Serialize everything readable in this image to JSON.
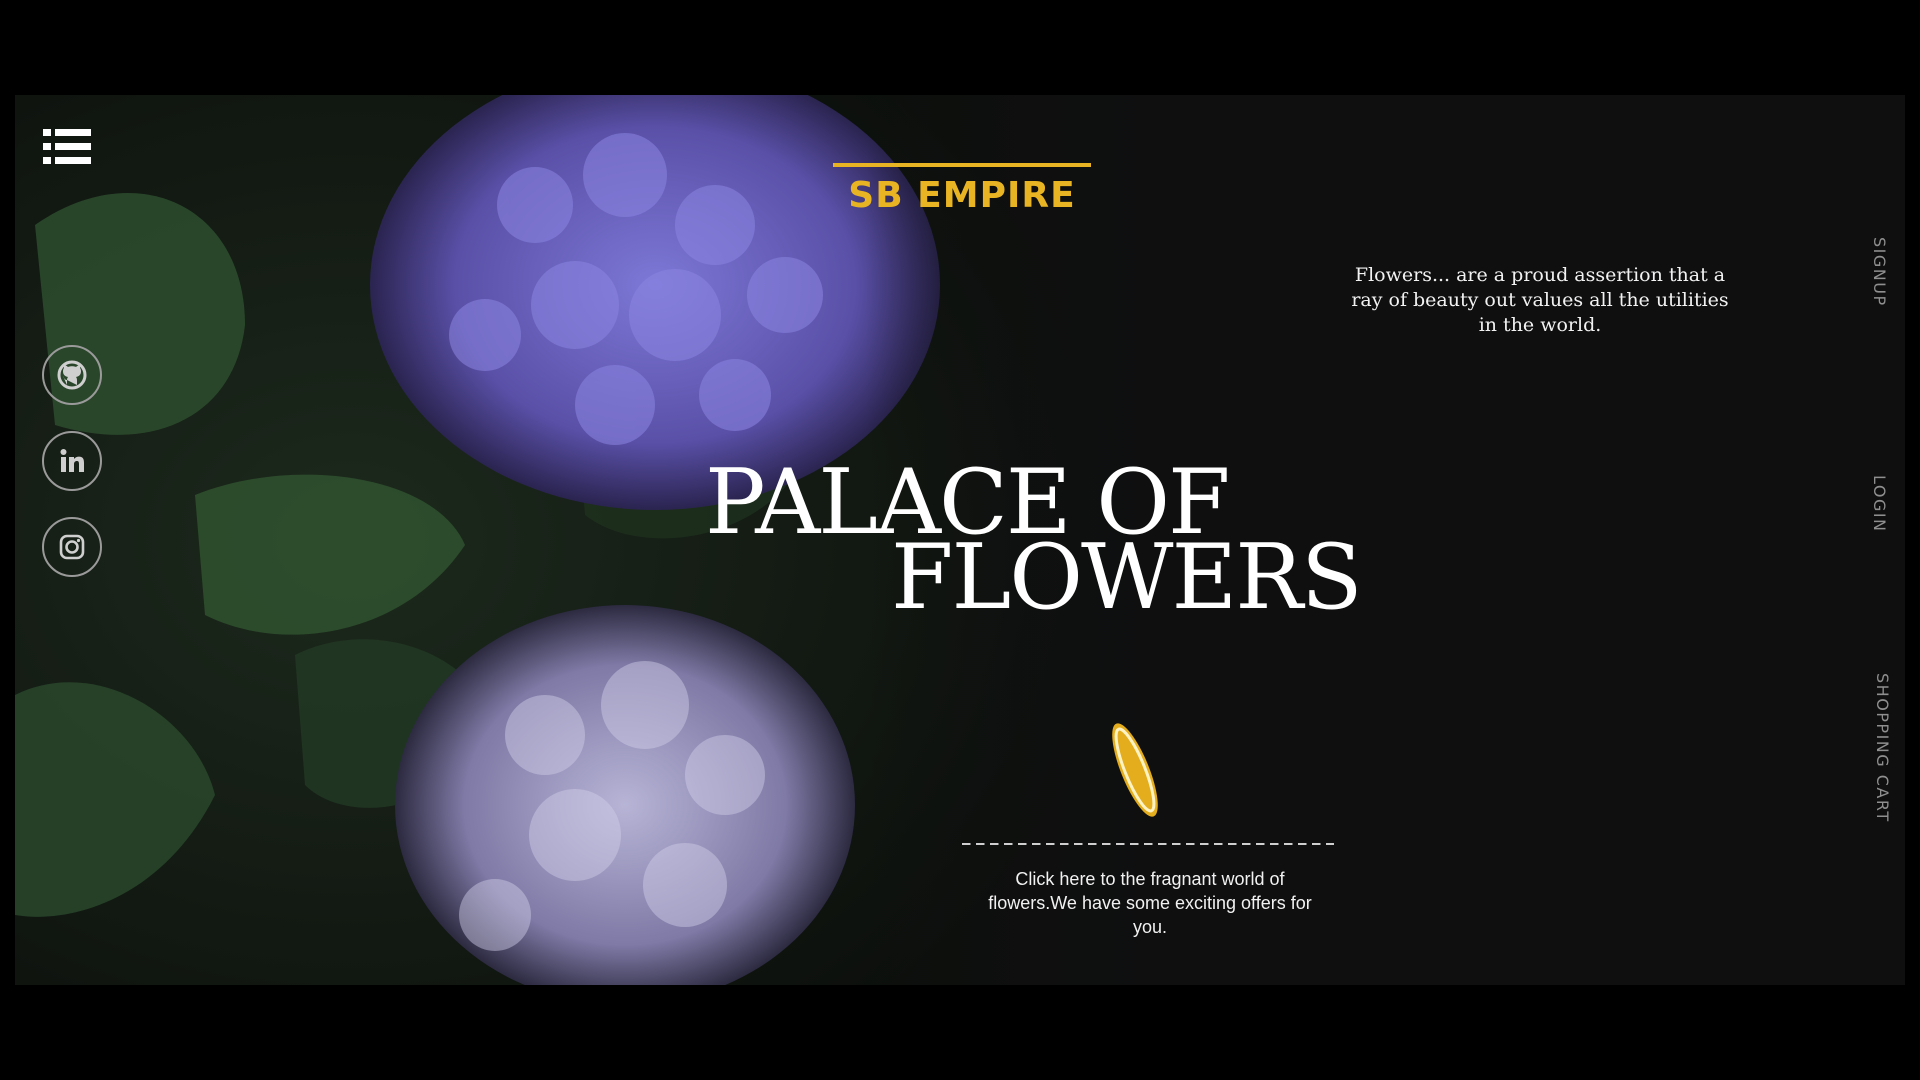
{
  "brand": {
    "name": "SB EMPIRE",
    "accent_color": "#e9b423"
  },
  "header": {
    "menu_icon": "hamburger-list-icon"
  },
  "social": [
    {
      "name": "github",
      "icon": "github-icon"
    },
    {
      "name": "linkedin",
      "icon": "linkedin-icon"
    },
    {
      "name": "instagram",
      "icon": "instagram-icon"
    }
  ],
  "hero": {
    "quote": "Flowers... are a proud assertion that a ray of beauty out values all the utilities in the world.",
    "title_line1": "PALACE OF",
    "title_line2": "FLOWERS",
    "cta_text": "Click here to the fragnant world of flowers.We have some exciting offers for you.",
    "cta_icon": "golden-petal-icon"
  },
  "side_nav": {
    "signup": "SIGNUP",
    "login": "LOGIN",
    "cart": "SHOPPING CART"
  }
}
